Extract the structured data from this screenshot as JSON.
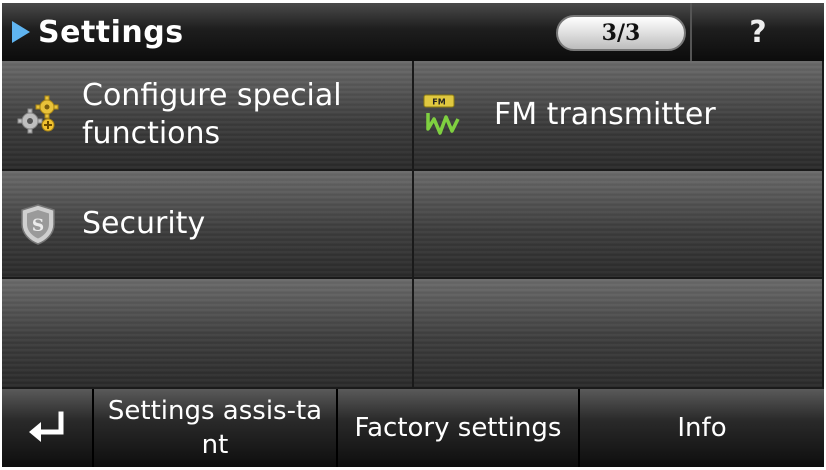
{
  "header": {
    "title": "Settings",
    "page_indicator": "3/3",
    "help_label": "?"
  },
  "menu": {
    "items": [
      {
        "label": "Configure special functions",
        "icon": "gears-icon"
      },
      {
        "label": "FM transmitter",
        "icon": "fm-transmitter-icon"
      },
      {
        "label": "Security",
        "icon": "shield-icon"
      },
      {
        "label": "",
        "icon": ""
      },
      {
        "label": "",
        "icon": ""
      },
      {
        "label": "",
        "icon": ""
      }
    ]
  },
  "footer": {
    "back_icon": "return-arrow-icon",
    "settings_assistant_label": "Settings assis-tant",
    "factory_settings_label": "Factory settings",
    "info_label": "Info"
  },
  "colors": {
    "accent_arrow": "#5fb4f0",
    "header_bg": "#1e1e1e",
    "text": "#ffffff"
  }
}
